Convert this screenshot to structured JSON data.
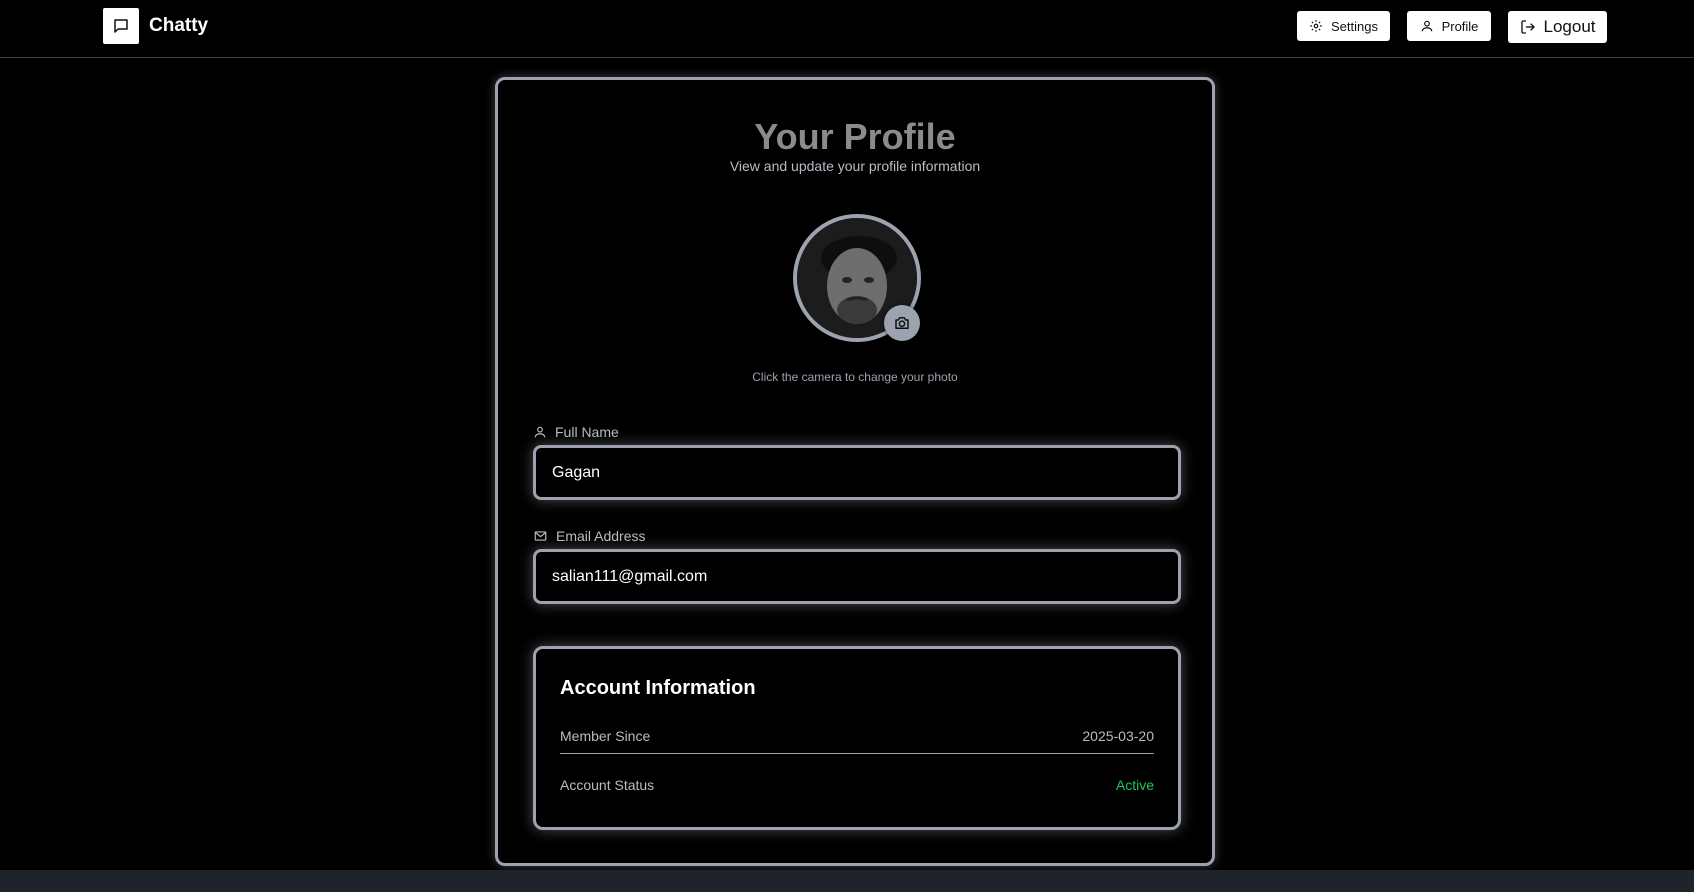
{
  "brand": {
    "name": "Chatty"
  },
  "nav": {
    "settings_label": "Settings",
    "profile_label": "Profile",
    "logout_label": "Logout"
  },
  "profile": {
    "title": "Your Profile",
    "subtitle": "View and update your profile information",
    "avatar_hint": "Click the camera to change your photo",
    "full_name_label": "Full Name",
    "full_name_value": "Gagan",
    "email_label": "Email Address",
    "email_value": "salian111@gmail.com"
  },
  "account": {
    "title": "Account Information",
    "member_since_label": "Member Since",
    "member_since_value": "2025-03-20",
    "status_label": "Account Status",
    "status_value": "Active"
  },
  "colors": {
    "background": "#000000",
    "border": "#9ca3af",
    "status_active": "#22c55e",
    "footer": "#1f242b"
  }
}
